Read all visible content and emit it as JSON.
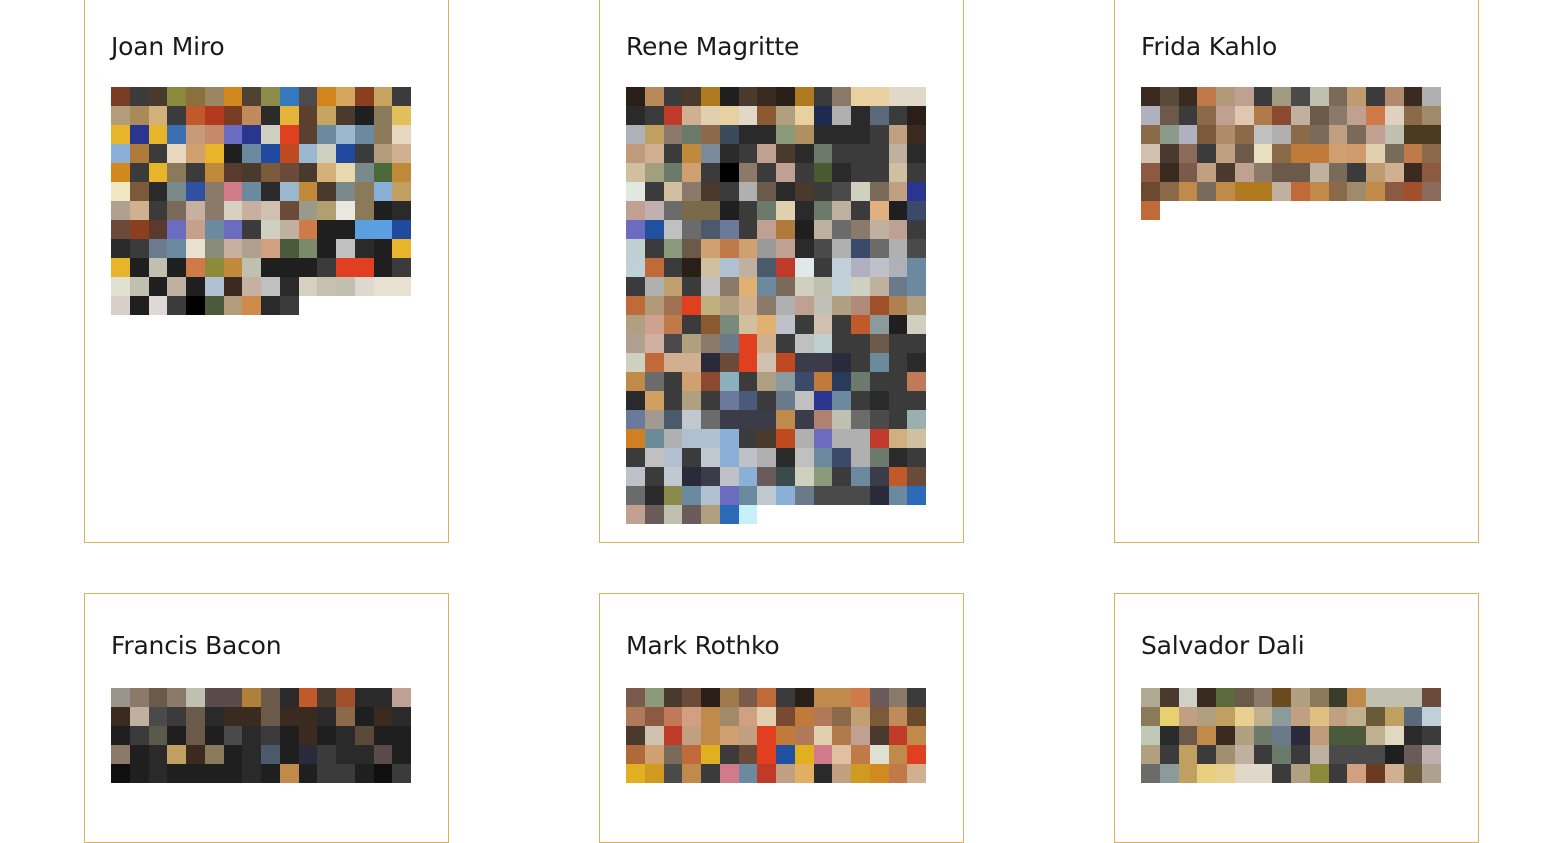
{
  "artists": [
    {
      "name": "Joan Miro",
      "swatches": [
        "#7a3b23",
        "#3b3b3b",
        "#4a3a2e",
        "#8a8a3a",
        "#8b6f3d",
        "#9a8660",
        "#d2881d",
        "#4f4232",
        "#8b8b4a",
        "#3279c0",
        "#4b4b4b",
        "#d4841d",
        "#d6a55e",
        "#8a3f1f",
        "#c7a560",
        "#3b3b3b",
        "#b39c7a",
        "#a88a5b",
        "#d2b07a",
        "#3b3b3b",
        "#c05a2a",
        "#b53a1d",
        "#7a3b23",
        "#c08a5a",
        "#2b2b2b",
        "#e4b43b",
        "#5b4030",
        "#c7a560",
        "#4a3a2e",
        "#1f1f1f",
        "#8b7a5a",
        "#e0c05a",
        "#e8b42a",
        "#2a3590",
        "#e8b42a",
        "#3c6fb0",
        "#c79a7a",
        "#c48a6a",
        "#6b6bc0",
        "#2a3590",
        "#d0d0c0",
        "#e04020",
        "#5a4030",
        "#6b8aa0",
        "#9ab8d0",
        "#6b8aa0",
        "#8b7a5a",
        "#e8d8c0",
        "#8ab0d8",
        "#b07a3a",
        "#3b3b3b",
        "#e8d8c0",
        "#d0a070",
        "#e8b42a",
        "#1f1f1f",
        "#6b8aa0",
        "#1f4aa0",
        "#c04a20",
        "#9ab8d0",
        "#d0d0c0",
        "#1f4aa0",
        "#3b3b3b",
        "#b39c7a",
        "#d0b090",
        "#d2881d",
        "#3b3b3b",
        "#e8b42a",
        "#8b7a5a",
        "#3b3b3b",
        "#c08a3a",
        "#5a3a2e",
        "#4a3a2e",
        "#7a5a3a",
        "#6b4a3a",
        "#4a3a2e",
        "#d6b07a",
        "#e8d8b0",
        "#7a8a8a",
        "#4a6a3a",
        "#c08a3a",
        "#f0e8c0",
        "#7a5a3a",
        "#2a2a2a",
        "#7a8a8a",
        "#3050a0",
        "#8b7a6a",
        "#d07a8a",
        "#6b8aa0",
        "#2a2a2a",
        "#9ab8d0",
        "#c08a3a",
        "#4a3a2e",
        "#7a8a8a",
        "#8b7a5a",
        "#8ab0d8",
        "#c0a060",
        "#b0a090",
        "#d0b090",
        "#3b3b3b",
        "#7a6a5a",
        "#c7b0a0",
        "#8b7a6a",
        "#d8d0c0",
        "#c7b0a0",
        "#d0c0b0",
        "#6b4a3a",
        "#9a9a8a",
        "#b0a070",
        "#e8e8e0",
        "#8b7a5a",
        "#1f1f1f",
        "#2a2a2a",
        "#6b4a3a",
        "#8a3f1f",
        "#5a3a2e",
        "#6b6bc0",
        "#c7a08a",
        "#6b8aa0",
        "#6b6bc0",
        "#3b3b3b",
        "#d0d0c0",
        "#c0b0a0",
        "#d07a4a",
        "#1f1f1f",
        "#1f1f1f",
        "#5aa0e0",
        "#5aa0e0",
        "#1f4aa0",
        "#2a2a2a",
        "#3b3b3b",
        "#6b7a90",
        "#6b8aa0",
        "#e8e0d0",
        "#8b8b7a",
        "#c7b0a0",
        "#b0a090",
        "#d0a080",
        "#4a5a3a",
        "#7a8a6a",
        "#1f1f1f",
        "#c0c0c0",
        "#2a2a2a",
        "#1f1f1f",
        "#e8b42a",
        "#e8b42a",
        "#1f1f1f",
        "#c0c0b0",
        "#1f1f1f",
        "#d07a4a",
        "#8b8b3a",
        "#c08a3a",
        "#c0c0b0",
        "#1f1f1f",
        "#1f1f1f",
        "#1f1f1f",
        "#3b3b3b",
        "#e04020",
        "#e04020",
        "#1f1f1f",
        "#3b3b3b",
        "#e0e0d0",
        "#c0c0b0",
        "#1f1f1f",
        "#c0b0a0",
        "#1f1f1f",
        "#b0c0d0",
        "#3a2a20",
        "#c7b0a0",
        "#c0c0c0",
        "#2a2a2a",
        "#d8d0c0",
        "#c7c0b0",
        "#c0c0b0",
        "#e0d8d0",
        "#e8e0d0",
        "#e8e0d0",
        "#d8d0c8",
        "#1f1f1f",
        "#e0d8d8",
        "#3b3b3b",
        "#000000",
        "#4a5a3a",
        "#b39c7a",
        "#d08a4a",
        "#2a2a2a",
        "#3b3b3b"
      ]
    },
    {
      "name": "Rene Magritte",
      "swatches": [
        "#2a1f18",
        "#b88a5a",
        "#3b3b3b",
        "#4a3a2e",
        "#b07a20",
        "#1f1f1f",
        "#4a3a2e",
        "#3b2a20",
        "#2a1f18",
        "#b07a20",
        "#3b3b3b",
        "#8b7a6a",
        "#e8d0a0",
        "#e8d0a0",
        "#e0d8c8",
        "#e0d8c8",
        "#2a2a2a",
        "#3b3b3b",
        "#c03a2a",
        "#d0b090",
        "#e0d0b0",
        "#e8d0a0",
        "#e0d8c8",
        "#8b5a30",
        "#b0a080",
        "#e8d0a0",
        "#1f2a50",
        "#b0b0b0",
        "#2a2a2a",
        "#5a6a7a",
        "#3b3b3b",
        "#2a1f18",
        "#b0b0b8",
        "#c0a060",
        "#8b7a6a",
        "#6b7a6a",
        "#8b6a4a",
        "#3b4a5a",
        "#2a2a2a",
        "#2a2a2a",
        "#8b9a7a",
        "#b09060",
        "#2a2a2a",
        "#2a2a2a",
        "#2a2a2a",
        "#3b3b3b",
        "#c0a080",
        "#3b2a20",
        "#c09a7a",
        "#d0b090",
        "#3b3b3b",
        "#c08a3a",
        "#7a8a9a",
        "#2a2a2a",
        "#3b3b3b",
        "#c0a090",
        "#4a3a2e",
        "#2a2a2a",
        "#6b7a6a",
        "#3b3b3b",
        "#3b3b3b",
        "#3b3b3b",
        "#c0b0a0",
        "#2a2a2a",
        "#d0c0a0",
        "#a0a080",
        "#6b7a6a",
        "#d0a070",
        "#3b3b3b",
        "#000000",
        "#8b7a6a",
        "#3b3b3b",
        "#c0a090",
        "#3b3b3b",
        "#4a5a30",
        "#2a2a2a",
        "#3b3b3b",
        "#3b3b3b",
        "#d0c0a0",
        "#3b3b3b",
        "#e0e8e0",
        "#3b3b3b",
        "#d0c0a0",
        "#8b7a6a",
        "#4a3a2e",
        "#3b3b3b",
        "#b0b0b0",
        "#6b5a4a",
        "#2a2a2a",
        "#4a3a2e",
        "#3b3b3b",
        "#4a4a4a",
        "#d0d0c0",
        "#7a6a5a",
        "#c0a080",
        "#2a3590",
        "#c0a090",
        "#c0b0b0",
        "#6b6b6b",
        "#7a6a4a",
        "#7a6a4a",
        "#1f1f1f",
        "#3b3b3b",
        "#6b7a6a",
        "#e0d0b0",
        "#2a2a2a",
        "#6b7a6a",
        "#c0b0a0",
        "#3b3b3b",
        "#e0b080",
        "#1f1f1f",
        "#3b4a6a",
        "#6b6bc0",
        "#2050a0",
        "#c0c0c0",
        "#6b6b6b",
        "#4a5a6a",
        "#6b7a9a",
        "#3b3b3b",
        "#c0a090",
        "#b07a3a",
        "#1f1f1f",
        "#c0b0a0",
        "#6b6b6b",
        "#8b7a6a",
        "#c0b0a0",
        "#c0a090",
        "#3b3b3b",
        "#c0d0d0",
        "#3b3b3b",
        "#8b9a7a",
        "#6b5a4a",
        "#d0a070",
        "#c07a4a",
        "#d0a070",
        "#9a9a9a",
        "#c0a090",
        "#2a2a2a",
        "#4a4a4a",
        "#b0b0b0",
        "#3b4a6a",
        "#6b6b6b",
        "#b0b0b0",
        "#4a4a4a",
        "#c0d0d8",
        "#c06a3a",
        "#3b3b3b",
        "#2a1f18",
        "#d0c0a0",
        "#b0c0d0",
        "#c0b0a0",
        "#4a5a6a",
        "#c03a2a",
        "#e0e8e8",
        "#3b3b3b",
        "#c0d0d8",
        "#b0b0c0",
        "#c0c0c8",
        "#b0b0b8",
        "#6b8aa0",
        "#3b3b3b",
        "#b0b0b0",
        "#c0a070",
        "#3b3b3b",
        "#c0c0c0",
        "#8b7a6a",
        "#e0b070",
        "#6b8aa0",
        "#7a6a5a",
        "#d0d0c0",
        "#c0c0b0",
        "#c0d0d8",
        "#d0d0c0",
        "#c0b0a0",
        "#6b7a8a",
        "#6b8aa0",
        "#c06a3a",
        "#b09a7a",
        "#a07050",
        "#e04020",
        "#c0b080",
        "#b0a080",
        "#d0b090",
        "#8b7a6a",
        "#b0b0b0",
        "#c0a090",
        "#c0c0b8",
        "#b0a080",
        "#b08a7a",
        "#a0502a",
        "#b08050",
        "#b0a080",
        "#b0a080",
        "#d0a090",
        "#c07a4a",
        "#3b3b3b",
        "#8b5a30",
        "#7a8a7a",
        "#d0c0a0",
        "#e0b070",
        "#c0c0c8",
        "#3b3b3b",
        "#d0c0b0",
        "#3b3b3b",
        "#c05a2a",
        "#8b9a9a",
        "#1f1f1f",
        "#d0d0c0",
        "#b0a090",
        "#d0b0a0",
        "#4a4a4a",
        "#b0a080",
        "#8b7a6a",
        "#6b7a8a",
        "#e04020",
        "#d0b090",
        "#3b3b3b",
        "#c0c0c0",
        "#c0d0d0",
        "#3b3b3b",
        "#3b3b3b",
        "#6b5a4a",
        "#3b3b3b",
        "#3b3b3b",
        "#d0d0c0",
        "#c06a3a",
        "#d0b090",
        "#d0b090",
        "#2a2a3a",
        "#6b4a3a",
        "#e04020",
        "#d0c0b0",
        "#c04a20",
        "#3b3b4a",
        "#3b3b4a",
        "#2a2a3a",
        "#3b3b3b",
        "#6b8a9a",
        "#3b3b3b",
        "#2a2a2a",
        "#c08a4a",
        "#6b6b6b",
        "#3b3b3b",
        "#d0a070",
        "#8b4a30",
        "#8ab0c0",
        "#3b3b3b",
        "#b0a080",
        "#8b9aa0",
        "#3b4a6a",
        "#c07a3a",
        "#2a3a5a",
        "#6b7a6a",
        "#3b3b3b",
        "#3b3b3b",
        "#c07a5a",
        "#2a2a2a",
        "#d0a060",
        "#3b3b3b",
        "#b0a080",
        "#3b3b3b",
        "#6b7a9a",
        "#4a5a7a",
        "#3b3b3b",
        "#6b7a8a",
        "#c0c0c0",
        "#2a3590",
        "#6b8aa0",
        "#3b3b3b",
        "#2a2a2a",
        "#3b3b3b",
        "#3b3b3b",
        "#6b7a9a",
        "#a09a90",
        "#4a5a6a",
        "#c0c8d0",
        "#6b6b6b",
        "#3b3b4a",
        "#3b3b4a",
        "#3b3b4a",
        "#c08a4a",
        "#3b3b4a",
        "#b08070",
        "#c0c0b0",
        "#6b6b6b",
        "#4a4a4a",
        "#3b3b3b",
        "#9ab0b0",
        "#d08020",
        "#6b8a9a",
        "#b0b0b0",
        "#b0c0d0",
        "#b0c0d0",
        "#8ab0d8",
        "#3b3b3b",
        "#4a3a2e",
        "#c04a20",
        "#b0b0b0",
        "#6b6bc0",
        "#b0b0b0",
        "#b0b0b0",
        "#c03a2a",
        "#d0b080",
        "#d0c0a0",
        "#3b3b3b",
        "#c0c0c0",
        "#b0c0d0",
        "#3b3b3b",
        "#c0c8d0",
        "#8ab0d8",
        "#c0c0c8",
        "#b0b0b0",
        "#2a2a2a",
        "#c0c0c0",
        "#6b8aa0",
        "#3b4a6a",
        "#b0b0b0",
        "#6b7a6a",
        "#2a2a2a",
        "#3b3b3b",
        "#c0c0c8",
        "#3b3b3b",
        "#c0c8d0",
        "#2a2a3a",
        "#3b3b4a",
        "#c0c0c8",
        "#8ab0d8",
        "#6b5a5a",
        "#3b4a4a",
        "#d0d0c0",
        "#8b9a7a",
        "#3b3b3b",
        "#6b8aa0",
        "#3b3b4a",
        "#c05a2a",
        "#6b4a3a",
        "#6b6b6b",
        "#2a2a2a",
        "#8b8a4a",
        "#6b8aa0",
        "#b0c0d0",
        "#6b6bc0",
        "#6b8aa0",
        "#c0c8d0",
        "#8ab0d8",
        "#6b7a8a",
        "#4a4a4a",
        "#4a4a4a",
        "#4a4a4a",
        "#2a2a3a",
        "#6b8aa0",
        "#2a6ab8",
        "#c0a090",
        "#6b5a5a",
        "#c0c0b0",
        "#6b5a5a",
        "#b0a080",
        "#2a6ab8",
        "#c8f0f8"
      ]
    },
    {
      "name": "Frida Kahlo",
      "swatches": [
        "#3b2a20",
        "#5a4a3a",
        "#3b2a20",
        "#c07a4a",
        "#b09a7a",
        "#c0a090",
        "#3b3b3b",
        "#a09a80",
        "#4a4a4a",
        "#c0c0b0",
        "#7a6a5a",
        "#c09a70",
        "#3b3b3b",
        "#b08a6a",
        "#3b2a20",
        "#b0b0b0",
        "#b0b0c0",
        "#6b5a4a",
        "#3b3b3b",
        "#8b6a4a",
        "#c0a090",
        "#e0c8b0",
        "#b07a4a",
        "#8b4a30",
        "#c0b0a0",
        "#6b5a4a",
        "#8b7a6a",
        "#c0a090",
        "#d07a4a",
        "#e0d0c0",
        "#8b6a4a",
        "#a08a6a",
        "#8b6a4a",
        "#8b9a8a",
        "#b0b0c0",
        "#7a5a3a",
        "#b08a6a",
        "#8b6a4a",
        "#c0c0c0",
        "#b0b0b0",
        "#8b6a4a",
        "#7a6a5a",
        "#c0a080",
        "#7a6a5a",
        "#c0a090",
        "#c0c0b0",
        "#4a3a20",
        "#4a3a20",
        "#d0c0b0",
        "#4a3a2e",
        "#8b6a5a",
        "#3b3b3b",
        "#c0a080",
        "#6b5a4a",
        "#e8e0c0",
        "#8b6a4a",
        "#c07a3a",
        "#c07a3a",
        "#d0a070",
        "#d09a6a",
        "#e0d0b0",
        "#7a6a5a",
        "#c07a4a",
        "#8b6a4a",
        "#8b5a40",
        "#3b2a20",
        "#7a5a4a",
        "#c0a080",
        "#4a3a2e",
        "#c0a090",
        "#8b7a6a",
        "#6b5a4a",
        "#6b5a4a",
        "#c0b0a0",
        "#7a6a5a",
        "#3b3b3b",
        "#c09a70",
        "#d0b090",
        "#3b2a20",
        "#8b5a40",
        "#6b4a30",
        "#8b6a4a",
        "#c08a4a",
        "#7a6a5a",
        "#c08a4a",
        "#b07a20",
        "#b07a20",
        "#c0b0a0",
        "#c06a3a",
        "#c08a4a",
        "#8b6a4a",
        "#a08a6a",
        "#c08a4a",
        "#8b5a40",
        "#a0502a",
        "#8b6a5a",
        "#c06a3a"
      ]
    },
    {
      "name": "Francis Bacon",
      "swatches": [
        "#9a948a",
        "#8b7a6a",
        "#6b5a4a",
        "#8b7a6a",
        "#c0c0b0",
        "#5a4a4a",
        "#5a4a4a",
        "#b0803a",
        "#6b5a4a",
        "#2a2a2a",
        "#c05a2a",
        "#4a3a2e",
        "#a0502a",
        "#2a2a2a",
        "#2a2a2a",
        "#c0a090",
        "#3b2a20",
        "#c0b0a0",
        "#4a4a4a",
        "#3b3b3b",
        "#6b5a4a",
        "#2a2a2a",
        "#3b2a20",
        "#3b2a20",
        "#6b5a4a",
        "#3b2a20",
        "#3b2a20",
        "#2a2a2a",
        "#8b6a4a",
        "#1f1f1f",
        "#3b2a20",
        "#2a2a2a",
        "#1f1f1f",
        "#3b3b3b",
        "#5a5a4a",
        "#1f1f1f",
        "#6b5a4a",
        "#1f1f1f",
        "#4a4a4a",
        "#2a2a2a",
        "#3b3b3b",
        "#1f1f1f",
        "#3b2a20",
        "#1f1f1f",
        "#2a2a2a",
        "#5a4a3a",
        "#1f1f1f",
        "#1f1f1f",
        "#8b7a6a",
        "#1f1f1f",
        "#2a2a2a",
        "#c0a060",
        "#3b2a20",
        "#8b7a5a",
        "#1f1f1f",
        "#2a2a2a",
        "#4a5a6a",
        "#1f1f1f",
        "#2a2a3a",
        "#3b3b3b",
        "#2a2a2a",
        "#2a2a2a",
        "#5a4a4a",
        "#1f1f1f",
        "#0f0f0f",
        "#1f1f1f",
        "#2a2a2a",
        "#1f1f1f",
        "#1f1f1f",
        "#1f1f1f",
        "#1f1f1f",
        "#2a2a2a",
        "#1f1f1f",
        "#c08a4a",
        "#1f1f1f",
        "#3b3b3b",
        "#3b3b3b",
        "#1f1f1f",
        "#0f0f0f",
        "#3b3b3b"
      ]
    },
    {
      "name": "Mark Rothko",
      "swatches": [
        "#7a5a4a",
        "#8b9a7a",
        "#4a3a2e",
        "#6b4a3a",
        "#2a1f18",
        "#a07a4a",
        "#7a5a4a",
        "#c06a3a",
        "#3b3b3b",
        "#2a1f18",
        "#c08a4a",
        "#c08a4a",
        "#d07a4a",
        "#6b5a5a",
        "#8b7a6a",
        "#3b3b3b",
        "#b07a5a",
        "#8b5a40",
        "#c07a5a",
        "#d0a080",
        "#c08a4a",
        "#a08a6a",
        "#d0a080",
        "#e0d0b0",
        "#7a4a30",
        "#c07a3a",
        "#b07a5a",
        "#8b6a4a",
        "#c0a070",
        "#7a5a3a",
        "#c08a5a",
        "#6b4a2a",
        "#4a3a2e",
        "#d0c0b0",
        "#c03a2a",
        "#c0a080",
        "#c08a4a",
        "#d0a070",
        "#c0a080",
        "#e04020",
        "#c07a3a",
        "#b07a5a",
        "#e0d0b0",
        "#b07a4a",
        "#c0a090",
        "#4a3a2e",
        "#c03a2a",
        "#c08a4a",
        "#b06a3a",
        "#d0a070",
        "#7a6a5a",
        "#c06a3a",
        "#e0b020",
        "#3b3b3b",
        "#6b4a3a",
        "#e04020",
        "#2050a0",
        "#e0b020",
        "#d07a8a",
        "#e0c0a0",
        "#c07a4a",
        "#e0e0d0",
        "#c08a4a",
        "#e04020",
        "#e0b020",
        "#d09a20",
        "#4a4a4a",
        "#c08a4a",
        "#3b3b3b",
        "#d07a8a",
        "#6b8aa0",
        "#c03a2a",
        "#c0a080",
        "#e0b060",
        "#2a2a2a",
        "#c0a080",
        "#d09a20",
        "#d08a20",
        "#c07a4a",
        "#d0b090"
      ]
    },
    {
      "name": "Salvador Dali",
      "swatches": [
        "#b0a890",
        "#4a3a2e",
        "#d0d0c8",
        "#3b2a20",
        "#5a6a3a",
        "#6b5a4a",
        "#8b7a6a",
        "#6b4a20",
        "#b0a080",
        "#8b7a5a",
        "#3b3b2a",
        "#c08a4a",
        "#c0c0b0",
        "#c0c0b0",
        "#c0c0b0",
        "#6b4a3a",
        "#8b7a5a",
        "#e8d070",
        "#c0a080",
        "#b0a080",
        "#c0a060",
        "#e8d090",
        "#c0b090",
        "#8b9a9a",
        "#c0a080",
        "#e0c080",
        "#c0a080",
        "#c0b090",
        "#6b5a3a",
        "#c0a060",
        "#5a6a7a",
        "#c0d0d8",
        "#c0c8b8",
        "#2a2a2a",
        "#6b5a4a",
        "#c08a4a",
        "#3b2a20",
        "#b0a080",
        "#6b7a6a",
        "#6b7a8a",
        "#2a2a3a",
        "#c09a7a",
        "#4a5a3a",
        "#4a5a3a",
        "#c0b090",
        "#e0d8c0",
        "#2a2a2a",
        "#3b3b3b",
        "#b0a080",
        "#3b3b3b",
        "#c0a060",
        "#3b3b3b",
        "#a09070",
        "#c0b0a0",
        "#3b3b3b",
        "#6b7a6a",
        "#3b3b3b",
        "#c0b0a0",
        "#4a4a4a",
        "#4a4a4a",
        "#4a4a4a",
        "#1f1f1f",
        "#6b5a5a",
        "#c0b0b0",
        "#6b6b6a",
        "#8b9a9a",
        "#c0a060",
        "#e8d080",
        "#e8d090",
        "#e0d8c8",
        "#e0d8c8",
        "#3b3b3b",
        "#b0a080",
        "#8b8a3a",
        "#3b3b3b",
        "#d0a080",
        "#6b3a20",
        "#d0b090",
        "#6b5a3a",
        "#b0a090"
      ]
    }
  ]
}
